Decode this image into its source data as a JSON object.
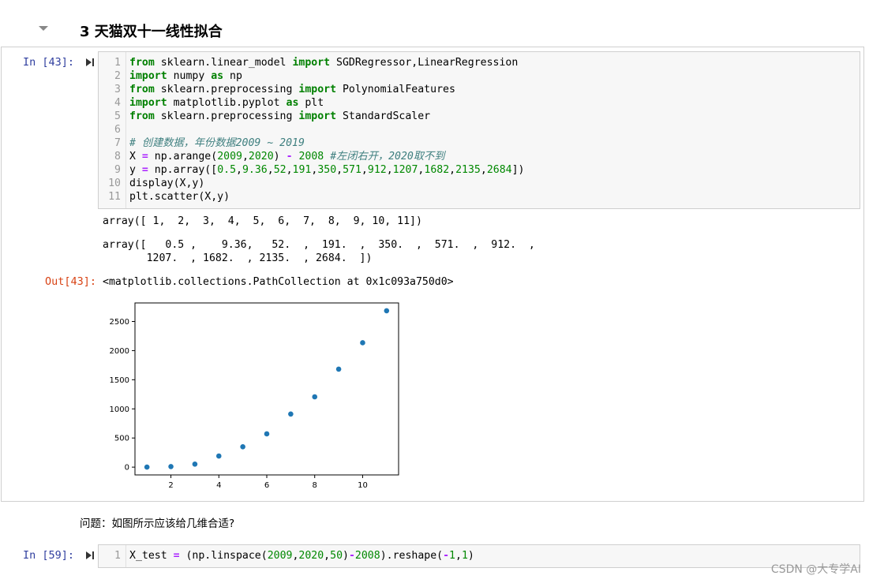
{
  "heading": {
    "text": "3 天猫双十一线性拟合"
  },
  "cell1": {
    "in_prompt": "In [43]:",
    "out_prompt": "Out[43]:",
    "code": [
      [
        {
          "t": "kw",
          "v": "from"
        },
        {
          "t": "",
          "v": " sklearn.linear_model "
        },
        {
          "t": "kw",
          "v": "import"
        },
        {
          "t": "",
          "v": " SGDRegressor,LinearRegression"
        }
      ],
      [
        {
          "t": "kw",
          "v": "import"
        },
        {
          "t": "",
          "v": " numpy "
        },
        {
          "t": "kw",
          "v": "as"
        },
        {
          "t": "",
          "v": " np"
        }
      ],
      [
        {
          "t": "kw",
          "v": "from"
        },
        {
          "t": "",
          "v": " sklearn.preprocessing "
        },
        {
          "t": "kw",
          "v": "import"
        },
        {
          "t": "",
          "v": " PolynomialFeatures"
        }
      ],
      [
        {
          "t": "kw",
          "v": "import"
        },
        {
          "t": "",
          "v": " matplotlib.pyplot "
        },
        {
          "t": "kw",
          "v": "as"
        },
        {
          "t": "",
          "v": " plt"
        }
      ],
      [
        {
          "t": "kw",
          "v": "from"
        },
        {
          "t": "",
          "v": " sklearn.preprocessing "
        },
        {
          "t": "kw",
          "v": "import"
        },
        {
          "t": "",
          "v": " StandardScaler"
        }
      ],
      [],
      [
        {
          "t": "cmt",
          "v": "# 创建数据，年份数据2009 ~ 2019"
        }
      ],
      [
        {
          "t": "",
          "v": "X "
        },
        {
          "t": "op",
          "v": "="
        },
        {
          "t": "",
          "v": " np.arange("
        },
        {
          "t": "num",
          "v": "2009"
        },
        {
          "t": "",
          "v": ","
        },
        {
          "t": "num",
          "v": "2020"
        },
        {
          "t": "",
          "v": ") "
        },
        {
          "t": "op",
          "v": "-"
        },
        {
          "t": "",
          "v": " "
        },
        {
          "t": "num",
          "v": "2008"
        },
        {
          "t": "",
          "v": " "
        },
        {
          "t": "cmt",
          "v": "#左闭右开，2020取不到"
        }
      ],
      [
        {
          "t": "",
          "v": "y "
        },
        {
          "t": "op",
          "v": "="
        },
        {
          "t": "",
          "v": " np.array(["
        },
        {
          "t": "num",
          "v": "0.5"
        },
        {
          "t": "",
          "v": ","
        },
        {
          "t": "num",
          "v": "9.36"
        },
        {
          "t": "",
          "v": ","
        },
        {
          "t": "num",
          "v": "52"
        },
        {
          "t": "",
          "v": ","
        },
        {
          "t": "num",
          "v": "191"
        },
        {
          "t": "",
          "v": ","
        },
        {
          "t": "num",
          "v": "350"
        },
        {
          "t": "",
          "v": ","
        },
        {
          "t": "num",
          "v": "571"
        },
        {
          "t": "",
          "v": ","
        },
        {
          "t": "num",
          "v": "912"
        },
        {
          "t": "",
          "v": ","
        },
        {
          "t": "num",
          "v": "1207"
        },
        {
          "t": "",
          "v": ","
        },
        {
          "t": "num",
          "v": "1682"
        },
        {
          "t": "",
          "v": ","
        },
        {
          "t": "num",
          "v": "2135"
        },
        {
          "t": "",
          "v": ","
        },
        {
          "t": "num",
          "v": "2684"
        },
        {
          "t": "",
          "v": "])"
        }
      ],
      [
        {
          "t": "",
          "v": "display(X,y)"
        }
      ],
      [
        {
          "t": "",
          "v": "plt.scatter(X,y)"
        }
      ]
    ],
    "output1": "array([ 1,  2,  3,  4,  5,  6,  7,  8,  9, 10, 11])",
    "output2": "array([   0.5 ,    9.36,   52.  ,  191.  ,  350.  ,  571.  ,  912.  ,\n       1207.  , 1682.  , 2135.  , 2684.  ])",
    "output3": "<matplotlib.collections.PathCollection at 0x1c093a750d0>"
  },
  "markdown": {
    "text": "问题：如图所示应该给几维合适?"
  },
  "cell2": {
    "in_prompt": "In [59]:",
    "code": [
      [
        {
          "t": "",
          "v": "X_test "
        },
        {
          "t": "op",
          "v": "="
        },
        {
          "t": "",
          "v": " (np.linspace("
        },
        {
          "t": "num",
          "v": "2009"
        },
        {
          "t": "",
          "v": ","
        },
        {
          "t": "num",
          "v": "2020"
        },
        {
          "t": "",
          "v": ","
        },
        {
          "t": "num",
          "v": "50"
        },
        {
          "t": "",
          "v": ")"
        },
        {
          "t": "op",
          "v": "-"
        },
        {
          "t": "num",
          "v": "2008"
        },
        {
          "t": "",
          "v": ").reshape("
        },
        {
          "t": "op",
          "v": "-"
        },
        {
          "t": "num",
          "v": "1"
        },
        {
          "t": "",
          "v": ","
        },
        {
          "t": "num",
          "v": "1"
        },
        {
          "t": "",
          "v": ")"
        }
      ]
    ]
  },
  "watermark": "CSDN @大专学AI",
  "chart_data": {
    "type": "scatter",
    "x": [
      1,
      2,
      3,
      4,
      5,
      6,
      7,
      8,
      9,
      10,
      11
    ],
    "y": [
      0.5,
      9.36,
      52,
      191,
      350,
      571,
      912,
      1207,
      1682,
      2135,
      2684
    ],
    "xlim": [
      0.5,
      11.5
    ],
    "ylim": [
      -133.7,
      2818.2
    ],
    "xticks": [
      2,
      4,
      6,
      8,
      10
    ],
    "yticks": [
      0,
      500,
      1000,
      1500,
      2000,
      2500
    ],
    "marker_color": "#1f77b4",
    "grid": false
  }
}
